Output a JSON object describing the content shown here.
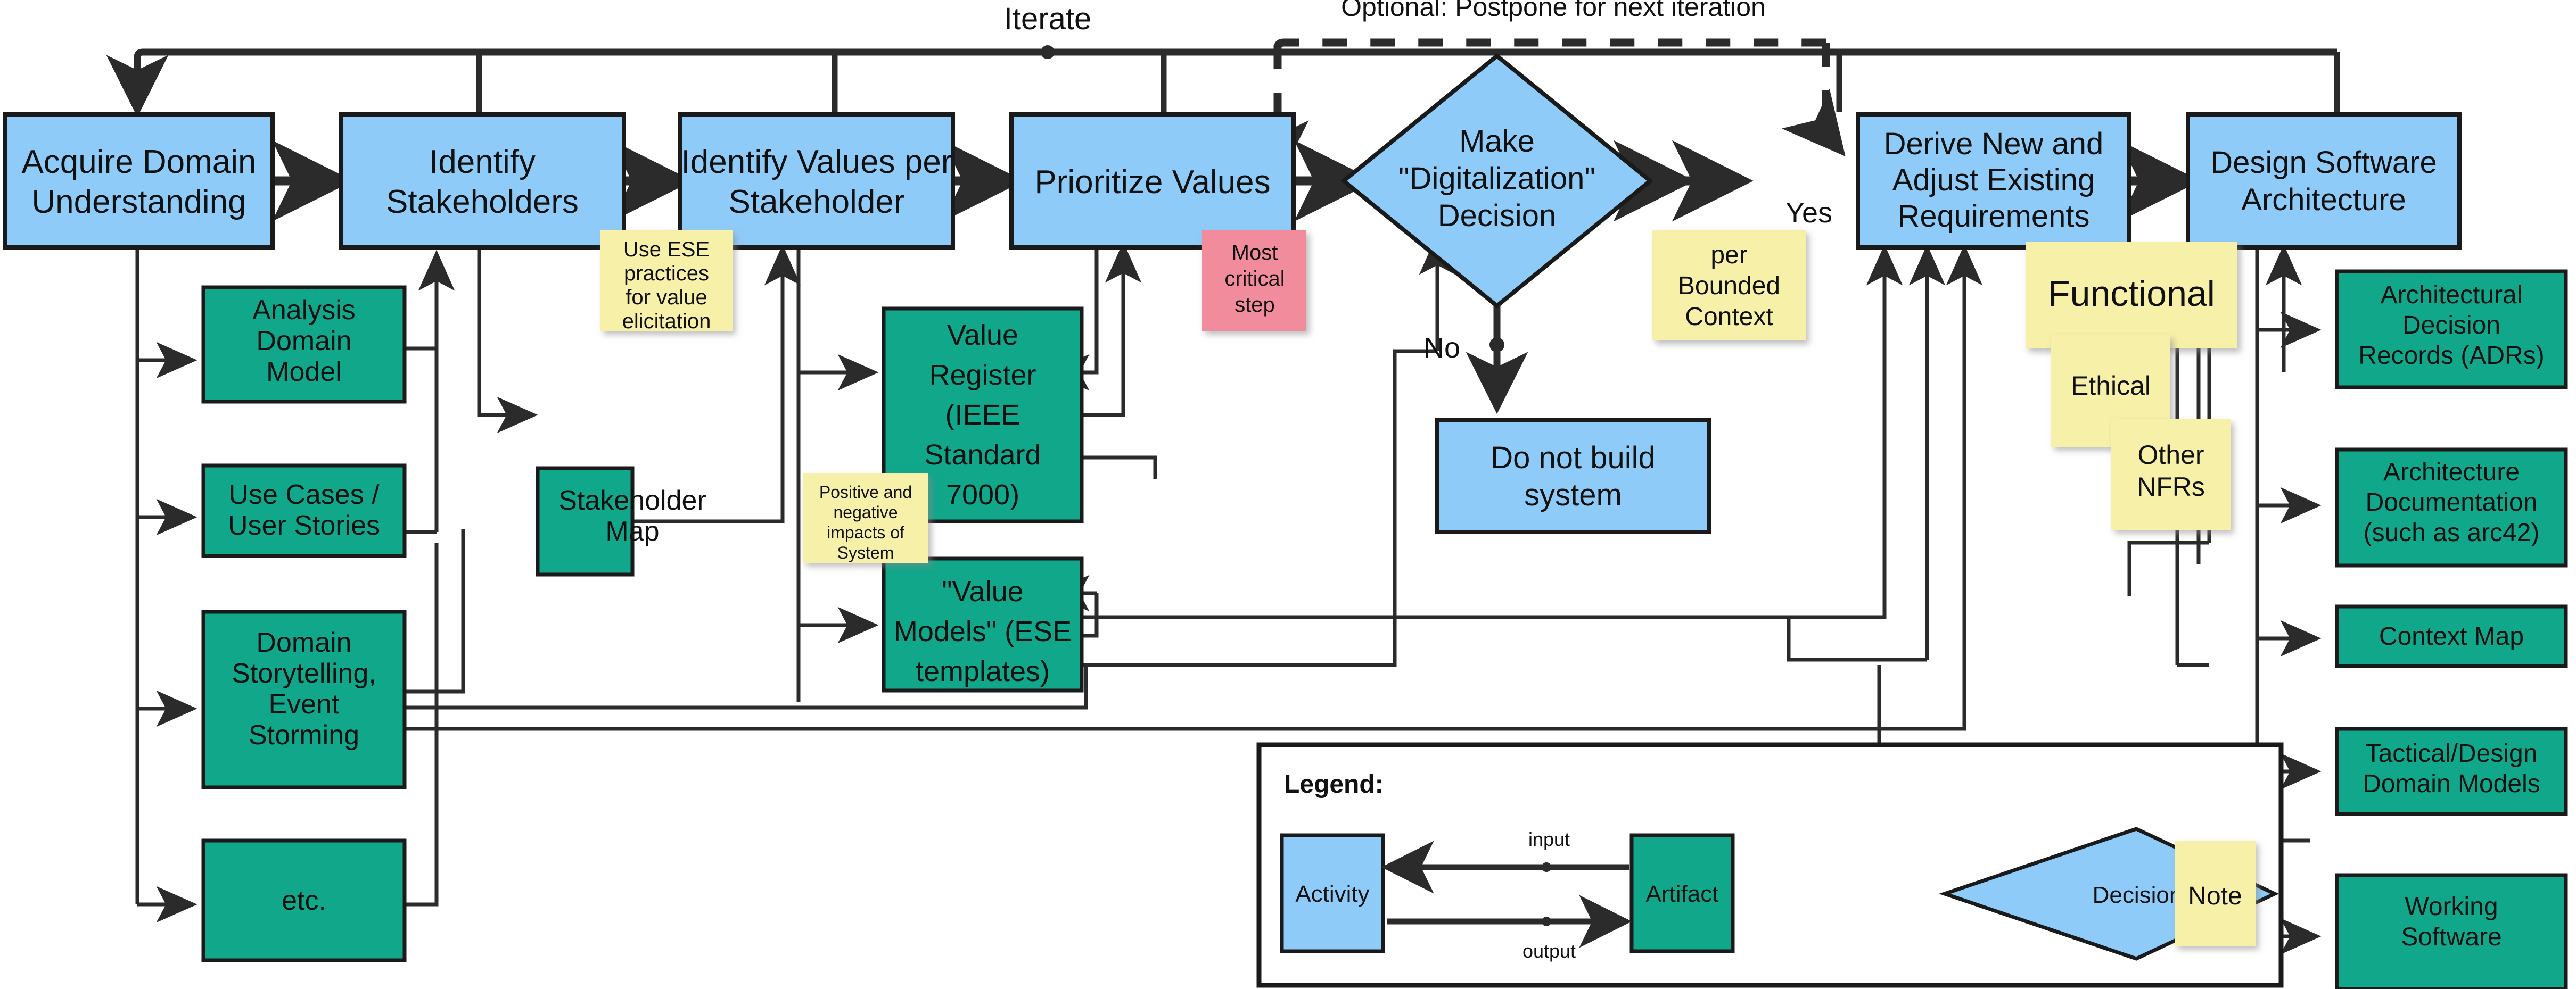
{
  "diagram": {
    "title_labels": {
      "iterate": "Iterate",
      "optional_postpone": "Optional: Postpone for next iteration",
      "yes": "Yes",
      "no": "No"
    },
    "activities": [
      {
        "id": "acquire",
        "label_lines": [
          "Acquire Domain",
          "Understanding"
        ]
      },
      {
        "id": "stake",
        "label_lines": [
          "Identify",
          "Stakeholders"
        ]
      },
      {
        "id": "values",
        "label_lines": [
          "Identify Values per",
          "Stakeholder"
        ]
      },
      {
        "id": "prio",
        "label_lines": [
          "Prioritize Values"
        ]
      },
      {
        "id": "derive",
        "label_lines": [
          "Derive New and",
          "Adjust Existing",
          "Requirements"
        ]
      },
      {
        "id": "design",
        "label_lines": [
          "Design Software",
          "Architecture"
        ]
      },
      {
        "id": "dontbuild",
        "label_lines": [
          "Do not build",
          "system"
        ]
      }
    ],
    "decision": {
      "id": "digidec",
      "label_lines": [
        "Make",
        "\"Digitalization\"",
        "Decision"
      ]
    },
    "artifacts_left": [
      {
        "id": "adm",
        "label_lines": [
          "Analysis",
          "Domain",
          "Model"
        ]
      },
      {
        "id": "uc",
        "label_lines": [
          "Use Cases /",
          "User Stories"
        ]
      },
      {
        "id": "dse",
        "label_lines": [
          "Domain",
          "Storytelling,",
          "Event",
          "Storming"
        ]
      },
      {
        "id": "etc",
        "label_lines": [
          "etc."
        ]
      },
      {
        "id": "smap",
        "label_lines": [
          "Stakeholder",
          "Map"
        ]
      }
    ],
    "artifacts_mid": [
      {
        "id": "vreg",
        "label_lines": [
          "Value",
          "Register",
          "(IEEE",
          "Standard",
          "7000)"
        ]
      },
      {
        "id": "vmod",
        "label_lines": [
          "\"Value",
          "Models\" (ESE",
          "templates)"
        ]
      }
    ],
    "artifacts_right": [
      {
        "id": "adr",
        "label_lines": [
          "Architectural",
          "Decision",
          "Records (ADRs)"
        ]
      },
      {
        "id": "adoc",
        "label_lines": [
          "Architecture",
          "Documentation",
          "(such as arc42)"
        ]
      },
      {
        "id": "cmap",
        "label_lines": [
          "Context Map"
        ]
      },
      {
        "id": "tdm",
        "label_lines": [
          "Tactical/Design",
          "Domain Models"
        ]
      },
      {
        "id": "wsw",
        "label_lines": [
          "Working",
          "Software"
        ]
      }
    ],
    "notes": [
      {
        "id": "ese",
        "kind": "yellow",
        "label_lines": [
          "Use ESE",
          "practices",
          "for value",
          "elicitation"
        ]
      },
      {
        "id": "impacts",
        "kind": "yellow",
        "label_lines": [
          "Positive and",
          "negative",
          "impacts of",
          "System"
        ]
      },
      {
        "id": "critical",
        "kind": "pink",
        "label_lines": [
          "Most",
          "critical",
          "step"
        ]
      },
      {
        "id": "bounded",
        "kind": "yellow",
        "label_lines": [
          "per",
          "Bounded",
          "Context"
        ]
      },
      {
        "id": "functional",
        "kind": "yellow",
        "label_lines": [
          "Functional"
        ]
      },
      {
        "id": "ethical",
        "kind": "yellow",
        "label_lines": [
          "Ethical"
        ]
      },
      {
        "id": "nfrs",
        "kind": "yellow",
        "label_lines": [
          "Other",
          "NFRs"
        ]
      }
    ],
    "legend": {
      "title": "Legend:",
      "activity": "Activity",
      "artifact": "Artifact",
      "decision": "Decision",
      "note": "Note",
      "input": "input",
      "output": "output"
    },
    "colors": {
      "activity_fill": "#8FCBF8",
      "artifact_fill": "#10A78B",
      "note_yellow": "#F7F0A8",
      "note_pink": "#F08C9C",
      "stroke": "#1A1A1A",
      "thin_stroke": "#2B2B2B",
      "background": "#FFFFFF"
    }
  }
}
